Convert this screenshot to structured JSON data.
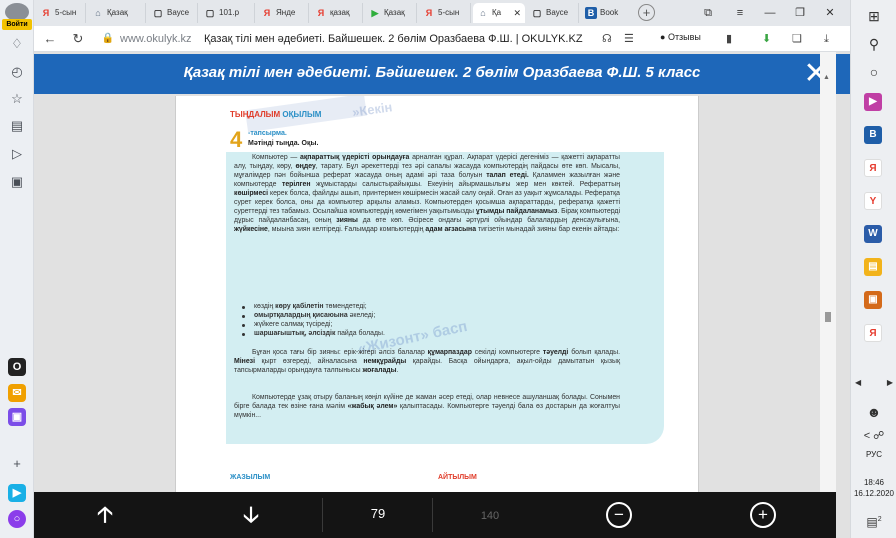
{
  "left_bar": {
    "login_label": "Войти",
    "icons": [
      "bell-icon",
      "clock-icon",
      "star-icon",
      "notes-icon",
      "play-icon",
      "apps-icon"
    ],
    "apps": [
      "odnoklassniki",
      "mail",
      "twitch",
      "plus"
    ]
  },
  "tabs": [
    {
      "icon": "Я",
      "label": "5-сын",
      "color": "#e63b2e"
    },
    {
      "icon": "⌂",
      "label": "Қазақ",
      "color": "#5a6b80"
    },
    {
      "icon": "▢",
      "label": "Ваусе",
      "color": "#444"
    },
    {
      "icon": "▢",
      "label": "101.р",
      "color": "#444"
    },
    {
      "icon": "Я",
      "label": "Янде",
      "color": "#e63b2e"
    },
    {
      "icon": "Я",
      "label": "қазақ",
      "color": "#e63b2e"
    },
    {
      "icon": "▶",
      "label": "Қазақ",
      "color": "#2fae3c"
    },
    {
      "icon": "Я",
      "label": "5-сын",
      "color": "#e63b2e"
    },
    {
      "icon": "⌂",
      "label": "Қа",
      "color": "#5a6b80",
      "active": true
    },
    {
      "icon": "▢",
      "label": "Ваусе",
      "color": "#444"
    },
    {
      "icon": "B",
      "label": "Book",
      "color": "#1f5ea8"
    }
  ],
  "address": {
    "domain": "www.okulyk.kz",
    "title": "Қазақ тілі мен әдебиеті. Байшешек. 2 бөлім Оразбаева Ф.Ш. | OKULYK.KZ",
    "reviews": "Отзывы"
  },
  "viewer": {
    "header_title": "Қазақ тілі мен әдебиеті. Бәйшешек. 2 бөлім Оразбаева Ф.Ш. 5 класс",
    "current_page": "79",
    "total_pages": "140"
  },
  "book": {
    "section_title_a": "ТЫҢДАЛЫМ",
    "section_title_b": "ОҚЫЛЫМ",
    "task_number": "4",
    "task_label": "-тапсырма.",
    "task_instruction": "Мәтінді тыңда. Оқы.",
    "watermark_top": "»Кекін",
    "watermark_mid": "«Жизонт» басп",
    "paragraph1": "Компьютер — <b>ақпараттық үдерісті орындауға</b> арналған құрал. Ақпарат үдерісі дегеніміз — қажетті ақпаратты алу, тыңдау, көру, <b>өңдеу</b>, тарату. Бұл әрекеттерді тез әрі сапалы жасауда компьютердің пайдасы өте көп. Мысалы, мұғалімдер пән бойынша реферат жасауда оның адамі әрі таза болуын <b>талап етеді.</b> Қаламмен жазылған және компьютерде <b>терілген</b> жұмыстарды салыстырайықшы. Екеуінің айырмашылығы жер мен көктей. Рефераттың <b>көшірмесі</b> керек болса, файлды ашып, принтермен көшірмесін жасай салу оңай. Оған аз уақыт жұмсалады. Рефератқа сурет керек болса, оны да компьютер арқылы аламыз. Компьютерден қосымша ақпараттарды, рефератқа қажетті суреттерді тез табамыз. Осылайша компьютердің көмегімен уақытымызды <b>ұтымды пайдаланамыз</b>. Бірақ компьютерді дұрыс пайдаланбасаң, оның <b>зияны</b> да өте көп. Әсіресе ондағы әртүрлі ойындар балалардың денсаулығына, <b>жүйкесіне</b>, мыына зиян келтіреді. Ғалымдар компьютердің <b>адам ағзасына</b> тигізетін мынадай зияны бар екенін айтады:",
    "bullets": [
      "көздің <b>көру қабілетін</b> төмендетеді;",
      "<b>омыртқалардың қисаюына</b> әкеледі;",
      "жүйкеге салмақ түсіреді;",
      "<b>шаршағыштық, әлсіздік</b> пайда болады."
    ],
    "paragraph2": "Бұған қоса тағы бір зияны: ерік-жігері әлсіз балалар <b>құмарпаздар</b> секілді компьютерге <b>тәуелді</b> болып қалады. <b>Мінезі</b> қырт өзгереді, айналасына <b>немқұрайды</b> қарайды. Басқа ойындарға, ақыл-ойды дамытатын қызық тапсырмаларды орындауға талпынысы <b>жоғалады</b>.",
    "paragraph3": "Компьютерде ұзақ отыру баланың көңіл күйіне де жаман әсер етеді, олар невнесе ашуланшақ болады. Сонымен бірге балада тек өзіне ғана мәлім <b>«жабық әлем»</b> қалыптасады. Компьютерге тәуелді бала өз достарын да жоғалтуы мүмкін...",
    "footer_left": "ЖАЗЫЛЫМ",
    "footer_mid": "АЙТЫЛЫМ"
  },
  "taskbar": {
    "lang": "РУС",
    "time": "18:46",
    "date": "16.12.2020",
    "notif_count": "2"
  },
  "colors": {
    "header": "#1e67b9",
    "panel": "#d3eef2",
    "accent_red": "#e03c2a",
    "accent_blue": "#2a8fc6"
  }
}
